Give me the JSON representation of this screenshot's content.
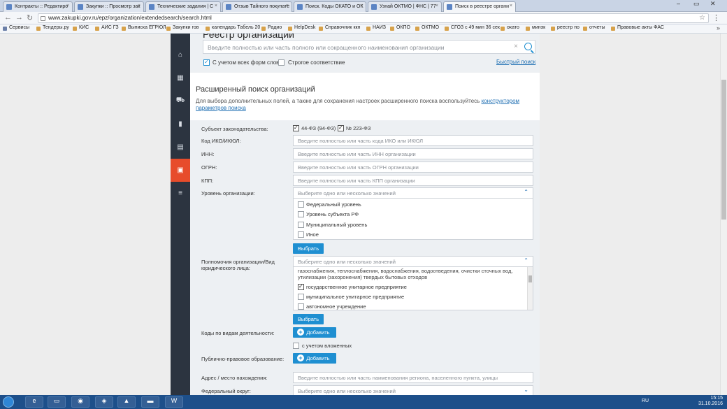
{
  "browser": {
    "tabs": [
      {
        "label": "Контракты :: Редактиро"
      },
      {
        "label": "Закупки :: Просмотр зак"
      },
      {
        "label": "Технические задания | С"
      },
      {
        "label": "Отзыв Тайного покупате"
      },
      {
        "label": "Поиск. Коды ОКАТО и ОК"
      },
      {
        "label": "Узнай ОКТМО | ФНС | 77"
      },
      {
        "label": "Поиск в реестре органи"
      }
    ],
    "url": "www.zakupki.gov.ru/epz/organization/extendedsearch/search.html",
    "bookmarks": [
      "Сервисы",
      "Тендеры.ру",
      "КИС",
      "АИС ГЗ",
      "Выписка ЕГРЮЛ",
      "Закупки гов",
      "календарь Табель 20",
      "Радио",
      "HelpDesk",
      "Справочник ккн",
      "НАИЗ",
      "ОКПО",
      "ОКТМО",
      "СГОЗ с 49 мин 36 сек",
      "окато",
      "минэк",
      "реестр по",
      "отчеты",
      "Правовые акты ФАС"
    ]
  },
  "quick_search": {
    "title": "Реестр организаций",
    "placeholder": "Введите полностью или часть полного или сокращенного наименования организации",
    "clear": "×",
    "opt_all_forms": "С учетом всех форм слов",
    "opt_strict": "Строгое соответствие",
    "quick_link": "Быстрый поиск"
  },
  "extended": {
    "title": "Расширенный поиск организаций",
    "desc_text": "Для выбора дополнительных полей, а также для сохранения настроек расширенного поиска воспользуйтесь ",
    "desc_link_1": "конструктором",
    "desc_link_2": "параметров поиска"
  },
  "form": {
    "law_label": "Субъект законодательства:",
    "law_44": "44-ФЗ (94-ФЗ)",
    "law_223": "№ 223-ФЗ",
    "iko_label": "Код ИКО/ИКЮЛ:",
    "iko_placeholder": "Введите полностью или часть кода ИКО или ИКЮЛ",
    "inn_label": "ИНН:",
    "inn_placeholder": "Введите полностью или часть ИНН организации",
    "ogrn_label": "ОГРН:",
    "ogrn_placeholder": "Введите полностью или часть ОГРН организации",
    "kpp_label": "КПП:",
    "kpp_placeholder": "Введите полностью или часть КПП организации",
    "level_label": "Уровень организации:",
    "select_placeholder": "Выберите одно или несколько значений",
    "level_options": [
      "Федеральный уровень",
      "Уровень субъекта РФ",
      "Муниципальный уровень",
      "Иное"
    ],
    "choose_btn": "Выбрать",
    "authority_label_1": "Полномочия организации/Вид",
    "authority_label_2": "юридического лица:",
    "authority_text_1": "газоснабжения, теплоснабжения, водоснабжения, водоотведения, очистки сточных вод,",
    "authority_text_2": "утилизации (захоронения) твердых бытовых отходов",
    "authority_options": [
      "государственное унитарное предприятие",
      "муниципальное унитарное предприятие",
      "автономное учреждение"
    ],
    "activity_label": "Коды по видам деятельности:",
    "add_btn": "Добавить",
    "nested_label": "с учетом вложенных",
    "public_label": "Публично-правовое образование:",
    "address_label": "Адрес / место нахождения:",
    "address_placeholder": "Введите полностью или часть наименования региона, населенного пункта, улицы",
    "district_label": "Федеральный округ:"
  },
  "taskbar": {
    "lang": "RU",
    "time": "15:15",
    "date": "31.10.2016"
  },
  "colors": {
    "accent": "#1f8fd1",
    "sidebar": "#2c3440",
    "active_side": "#e74c2b"
  }
}
